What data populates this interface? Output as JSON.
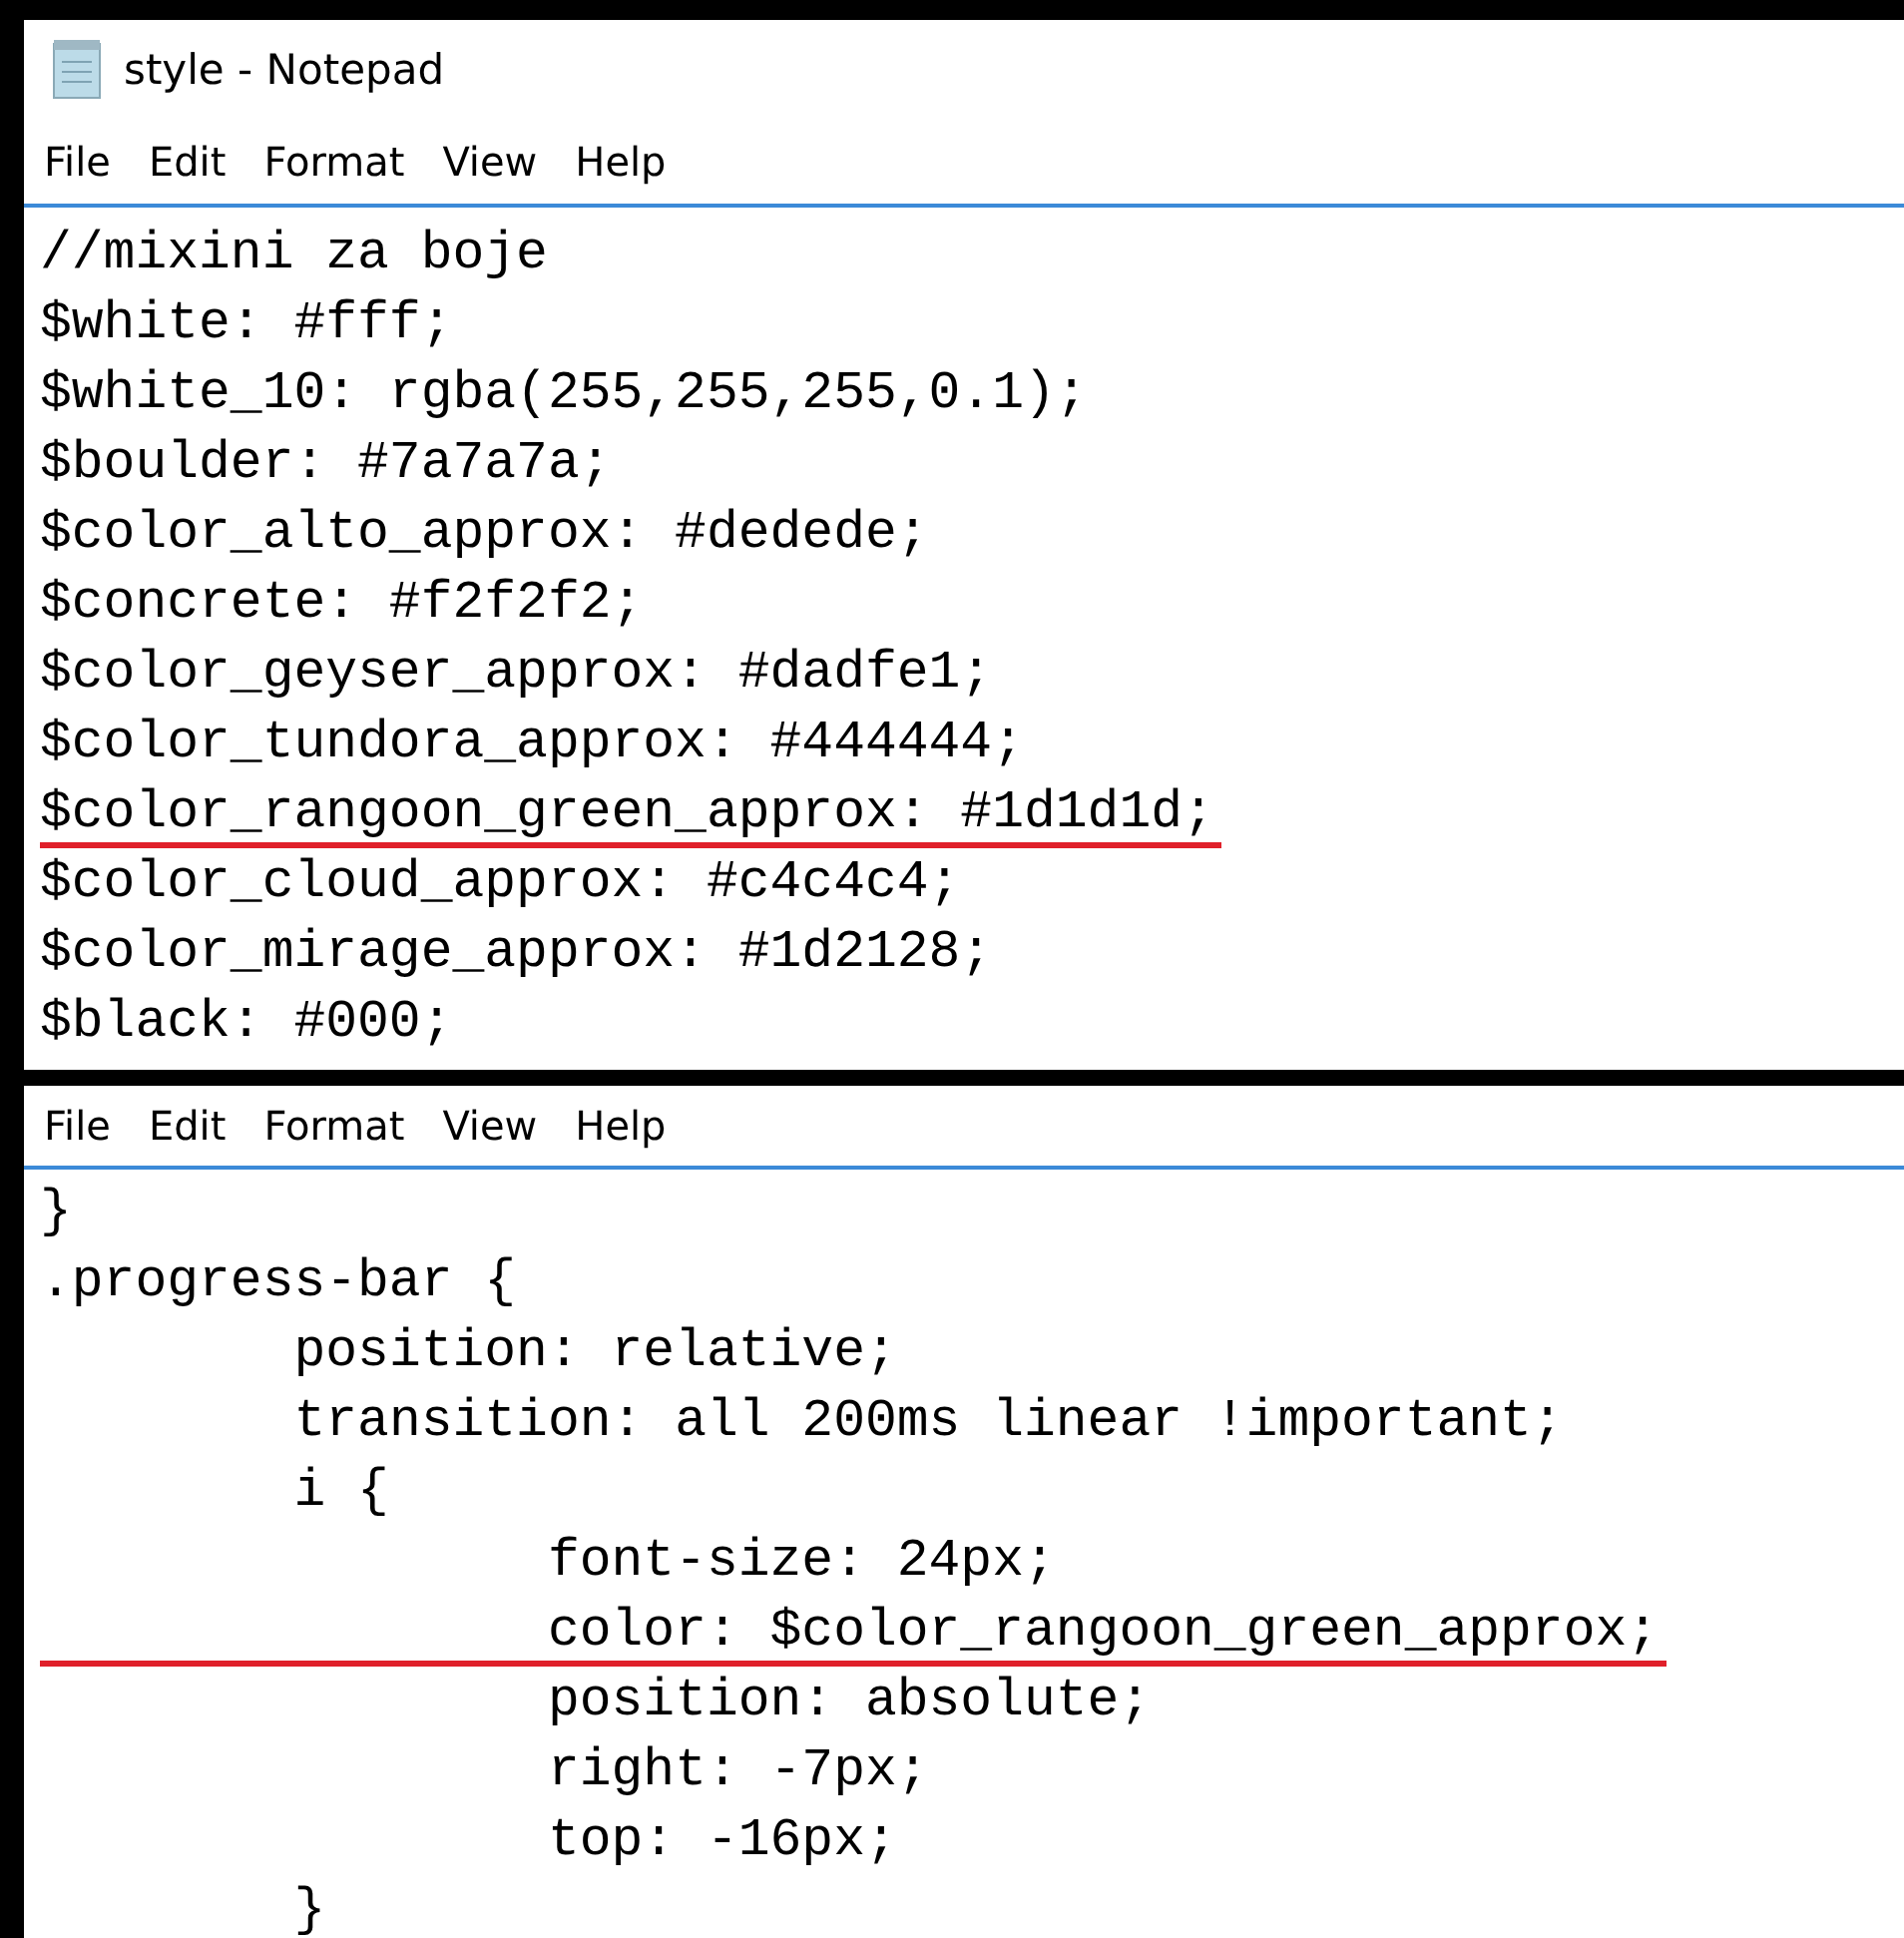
{
  "top_window": {
    "title": "style - Notepad",
    "menu": [
      "File",
      "Edit",
      "Format",
      "View",
      "Help"
    ],
    "lines": [
      {
        "text": "//mixini za boje",
        "underlined": false
      },
      {
        "text": "$white: #fff;",
        "underlined": false
      },
      {
        "text": "$white_10: rgba(255,255,255,0.1);",
        "underlined": false
      },
      {
        "text": "$boulder: #7a7a7a;",
        "underlined": false
      },
      {
        "text": "$color_alto_approx: #dedede;",
        "underlined": false
      },
      {
        "text": "$concrete: #f2f2f2;",
        "underlined": false
      },
      {
        "text": "$color_geyser_approx: #dadfe1;",
        "underlined": false
      },
      {
        "text": "$color_tundora_approx: #444444;",
        "underlined": false
      },
      {
        "text": "$color_rangoon_green_approx: #1d1d1d;",
        "underlined": true
      },
      {
        "text": "$color_cloud_approx: #c4c4c4;",
        "underlined": false
      },
      {
        "text": "$color_mirage_approx: #1d2128;",
        "underlined": false
      },
      {
        "text": "$black: #000;",
        "underlined": false
      }
    ]
  },
  "bottom_window": {
    "menu": [
      "File",
      "Edit",
      "Format",
      "View",
      "Help"
    ],
    "lines": [
      {
        "text": "}",
        "underlined": false
      },
      {
        "text": ".progress-bar {",
        "underlined": false
      },
      {
        "text": "\tposition: relative;",
        "underlined": false
      },
      {
        "text": "\ttransition: all 200ms linear !important;",
        "underlined": false
      },
      {
        "text": "\ti {",
        "underlined": false
      },
      {
        "text": "\t\tfont-size: 24px;",
        "underlined": false
      },
      {
        "text": "\t\tcolor: $color_rangoon_green_approx;",
        "underlined": true
      },
      {
        "text": "\t\tposition: absolute;",
        "underlined": false
      },
      {
        "text": "\t\tright: -7px;",
        "underlined": false
      },
      {
        "text": "\t\ttop: -16px;",
        "underlined": false
      },
      {
        "text": "\t}",
        "underlined": false
      }
    ]
  }
}
